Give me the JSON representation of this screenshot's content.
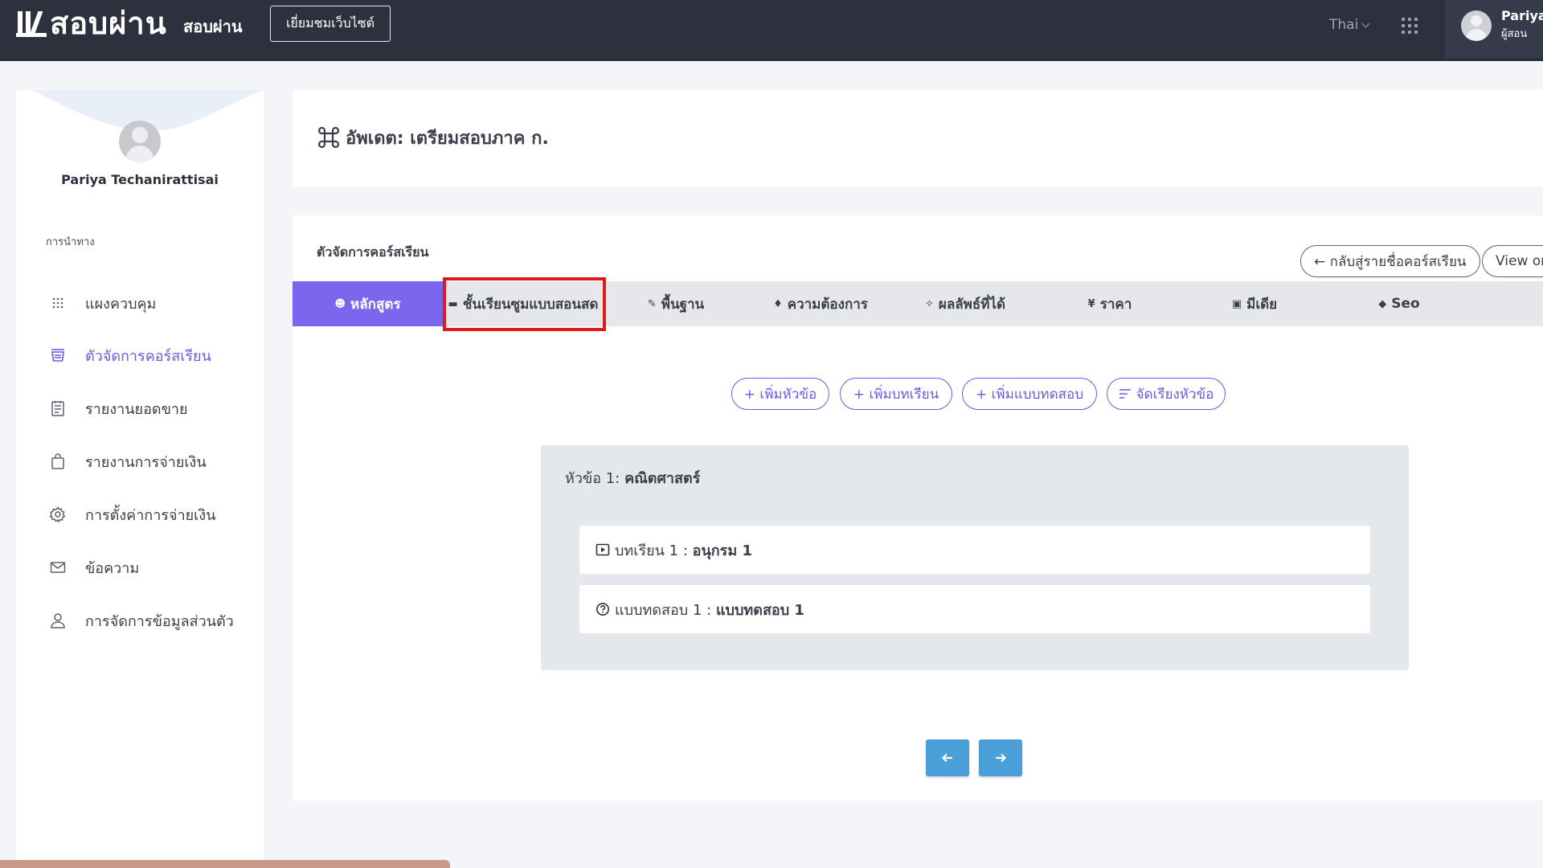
{
  "topbar": {
    "logo_text": "สอบผ่าน",
    "site_name": "สอบผ่าน",
    "visit_button": "เยี่ยมชมเว็บไซต์",
    "language": "Thai",
    "user_name": "Pariya",
    "user_role": "ผู้สอน"
  },
  "sidebar": {
    "user_full_name": "Pariya Techanirattisai",
    "nav_heading": "การนำทาง",
    "items": [
      {
        "label": "แผงควบคุม",
        "icon": "dots-grid-icon"
      },
      {
        "label": "ตัวจัดการคอร์สเรียน",
        "icon": "course-icon",
        "active": true
      },
      {
        "label": "รายงานยอดขาย",
        "icon": "report-icon"
      },
      {
        "label": "รายงานการจ่ายเงิน",
        "icon": "bag-icon"
      },
      {
        "label": "การตั้งค่าการจ่ายเงิน",
        "icon": "gear-icon"
      },
      {
        "label": "ข้อความ",
        "icon": "mail-icon"
      },
      {
        "label": "การจัดการข้อมูลส่วนตัว",
        "icon": "user-icon"
      }
    ]
  },
  "header": {
    "title": "อัพเดต: เตรียมสอบภาค ก."
  },
  "main": {
    "heading": "ตัวจัดการคอร์สเรียน",
    "back_button": "← กลับสู่รายชื่อคอร์สเรียน",
    "view_button": "View or",
    "tabs": [
      {
        "label": "หลักสูตร",
        "icon": "☻",
        "active": true
      },
      {
        "label": "ชั้นเรียนซูมแบบสอนสด",
        "icon": "▬"
      },
      {
        "label": "พื้นฐาน",
        "icon": "✎"
      },
      {
        "label": "ความต้องการ",
        "icon": "♦"
      },
      {
        "label": "ผลลัพธ์ที่ได้",
        "icon": "✧"
      },
      {
        "label": "ราคา",
        "icon": "¥"
      },
      {
        "label": "มีเดีย",
        "icon": "▣"
      },
      {
        "label": "Seo",
        "icon": "◆"
      }
    ],
    "actions": {
      "add_topic": "+ เพิ่มหัวข้อ",
      "add_lesson": "+ เพิ่มบทเรียน",
      "add_quiz": "+ เพิ่มแบบทดสอบ",
      "sort_topics": "จัดเรียงหัวข้อ"
    },
    "topic": {
      "prefix": "หัวข้อ 1:",
      "name": "คณิตศาสตร์",
      "items": [
        {
          "prefix": "บทเรียน 1 :",
          "name": "อนุกรม 1",
          "icon": "play-icon"
        },
        {
          "prefix": "แบบทดสอบ 1 :",
          "name": "แบบทดสอบ 1",
          "icon": "question-icon"
        }
      ]
    },
    "pager": {
      "prev_icon": "arrow-left-icon",
      "next_icon": "arrow-right-icon"
    }
  },
  "colors": {
    "topbar": "#2c313d",
    "accent": "#7a67ee",
    "button_blue": "#4a9fd8",
    "highlight": "#e01a1a"
  }
}
